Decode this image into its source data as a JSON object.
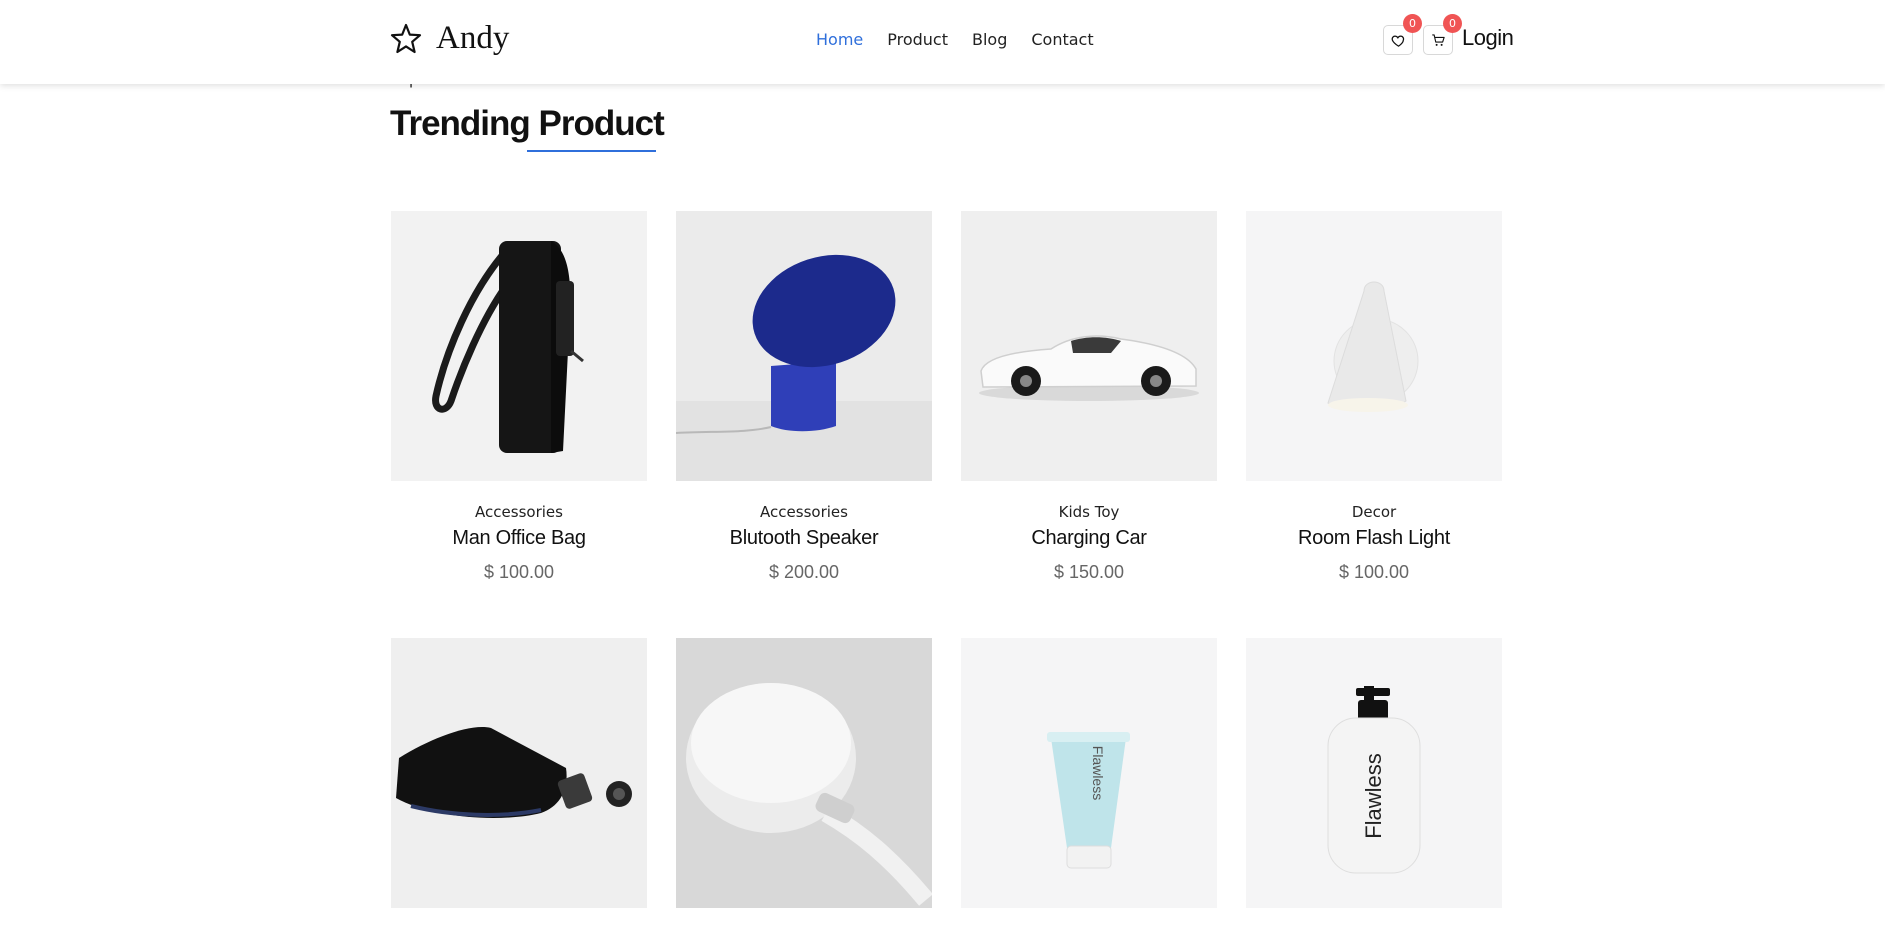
{
  "brand": {
    "name": "Andy"
  },
  "nav": [
    {
      "label": "Home",
      "active": true
    },
    {
      "label": "Product",
      "active": false
    },
    {
      "label": "Blog",
      "active": false
    },
    {
      "label": "Contact",
      "active": false
    }
  ],
  "header_actions": {
    "wishlist_count": "0",
    "cart_count": "0",
    "login_label": "Login"
  },
  "section": {
    "subtitle": "Popular item in the market",
    "title": "Trending Product"
  },
  "products": [
    {
      "category": "Accessories",
      "name": "Man Office Bag",
      "price": "$ 100.00"
    },
    {
      "category": "Accessories",
      "name": "Blutooth Speaker",
      "price": "$ 200.00"
    },
    {
      "category": "Kids Toy",
      "name": "Charging Car",
      "price": "$ 150.00"
    },
    {
      "category": "Decor",
      "name": "Room Flash Light",
      "price": "$ 100.00"
    },
    {
      "category": "",
      "name": "",
      "price": ""
    },
    {
      "category": "",
      "name": "",
      "price": ""
    },
    {
      "category": "",
      "name": "",
      "price": ""
    },
    {
      "category": "",
      "name": "",
      "price": ""
    }
  ],
  "product_images": [
    "backpack",
    "speaker",
    "car",
    "lamp",
    "pouch",
    "charger",
    "tube",
    "bottle"
  ],
  "image_text": {
    "tube": "Flawless",
    "bottle": "Flawless"
  },
  "colors": {
    "accent": "#2f6fdb",
    "badge": "#f05454"
  }
}
